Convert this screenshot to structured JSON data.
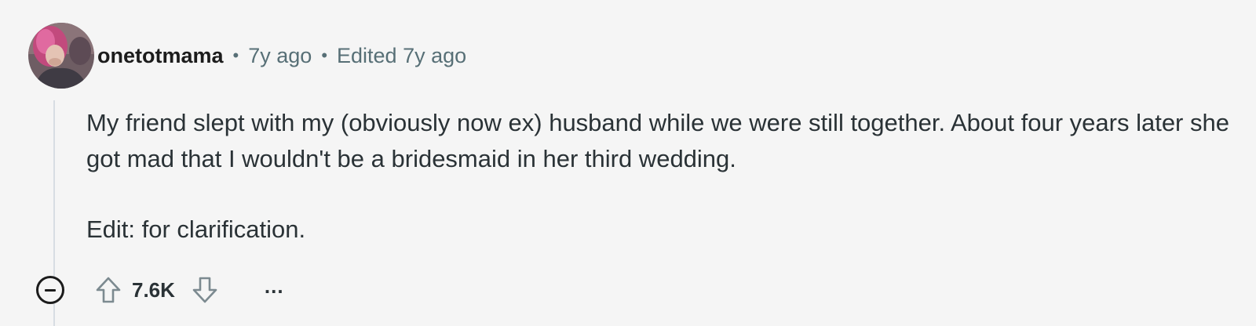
{
  "comment": {
    "username": "onetotmama",
    "separator": "•",
    "posted_time": "7y ago",
    "edited_label": "Edited 7y ago",
    "paragraphs": [
      "My friend slept with my (obviously now ex) husband while we were still together. About four years later she got mad that I wouldn't be a bridesmaid in her third wedding.",
      "Edit: for clarification."
    ],
    "score": "7.6K",
    "more_label": "..."
  },
  "icons": {
    "collapse": "minus-circle-icon",
    "upvote": "arrow-up-outline-icon",
    "downvote": "arrow-down-outline-icon"
  },
  "colors": {
    "background": "#f5f5f5",
    "text": "#2a3236",
    "meta": "#576f76",
    "thread_line": "#d8dde3"
  }
}
